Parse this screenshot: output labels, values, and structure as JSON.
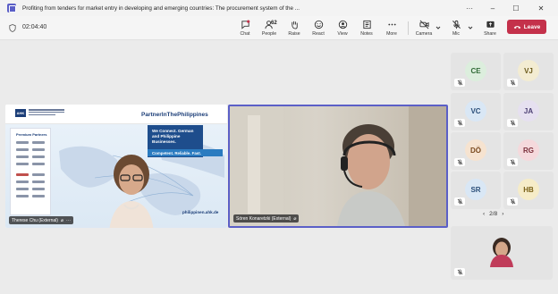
{
  "window": {
    "title": "Profiting from tenders for market entry in developing and emerging countries: The procurement system of the ...",
    "more_label": "···",
    "minimize": "–",
    "maximize": "☐",
    "close": "✕"
  },
  "toolbar": {
    "timer": "02:04:40",
    "people_count": "62",
    "items": {
      "chat": "Chat",
      "people": "People",
      "raise": "Raise",
      "react": "React",
      "view": "View",
      "notes": "Notes",
      "more": "More",
      "camera": "Camera",
      "mic": "Mic",
      "share": "Share"
    },
    "leave_label": "Leave"
  },
  "slide": {
    "org_logo": "AHK",
    "brand": "PartnerInThePhilippines",
    "partners_title": "Premium Partners",
    "card_text": "We Connect. German and Philippine Businesses.",
    "strip_text": "Competent. Reliable. Fast.",
    "url": "philippinen.ahk.de"
  },
  "participants": {
    "presenter_name": "Therese Chu (External)",
    "speaker_name": "Sören Konaretzki (External)",
    "rail": [
      {
        "initials": "CE",
        "color": "#dceedd",
        "text_color": "#2f6b35"
      },
      {
        "initials": "VJ",
        "color": "#f3ecd2",
        "text_color": "#6b5a1b"
      },
      {
        "initials": "VC",
        "color": "#d9e7f5",
        "text_color": "#2b4f7a"
      },
      {
        "initials": "JA",
        "color": "#e6e0f0",
        "text_color": "#4c3f73"
      },
      {
        "initials": "DÖ",
        "color": "#f6e3d0",
        "text_color": "#7a4a1e"
      },
      {
        "initials": "RG",
        "color": "#f5d9dc",
        "text_color": "#7a2f3a"
      },
      {
        "initials": "SR",
        "color": "#d9e7f5",
        "text_color": "#2b4f7a"
      },
      {
        "initials": "HB",
        "color": "#f6ecc8",
        "text_color": "#7a6118"
      }
    ]
  },
  "pager": {
    "label": "2/8",
    "prev": "‹",
    "next": "›"
  }
}
